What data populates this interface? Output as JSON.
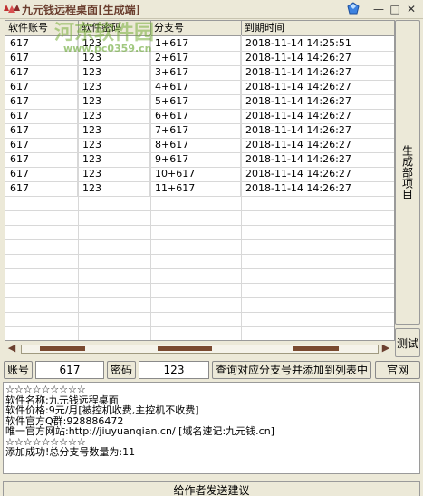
{
  "window": {
    "title": "九元钱远程桌面[生成端]",
    "controls": {
      "minimize": "—",
      "maximize": "□",
      "close": "✕"
    }
  },
  "watermark": {
    "main": "河东软件园",
    "url": "www.pc0359.cn"
  },
  "table": {
    "columns": [
      "软件账号",
      "软件密码",
      "分支号",
      "到期时间"
    ],
    "rows": [
      [
        "617",
        "123",
        "1+617",
        "2018-11-14 14:25:51"
      ],
      [
        "617",
        "123",
        "2+617",
        "2018-11-14 14:26:27"
      ],
      [
        "617",
        "123",
        "3+617",
        "2018-11-14 14:26:27"
      ],
      [
        "617",
        "123",
        "4+617",
        "2018-11-14 14:26:27"
      ],
      [
        "617",
        "123",
        "5+617",
        "2018-11-14 14:26:27"
      ],
      [
        "617",
        "123",
        "6+617",
        "2018-11-14 14:26:27"
      ],
      [
        "617",
        "123",
        "7+617",
        "2018-11-14 14:26:27"
      ],
      [
        "617",
        "123",
        "8+617",
        "2018-11-14 14:26:27"
      ],
      [
        "617",
        "123",
        "9+617",
        "2018-11-14 14:26:27"
      ],
      [
        "617",
        "123",
        "10+617",
        "2018-11-14 14:26:27"
      ],
      [
        "617",
        "123",
        "11+617",
        "2018-11-14 14:26:27"
      ]
    ]
  },
  "side": {
    "generate_label": "生成部项目",
    "test_label": "测试"
  },
  "form": {
    "account_label": "账号",
    "account_value": "617",
    "password_label": "密码",
    "password_value": "123",
    "query_button": "查询对应分支号并添加到列表中",
    "website_button": "官网"
  },
  "log": {
    "lines": [
      "☆☆☆☆☆☆☆☆☆",
      "软件名称:九元钱远程桌面",
      "软件价格:9元/月[被控机收费,主控机不收费]",
      "软件官方Q群:928886472",
      "唯一官方网站:http://jiuyuanqian.cn/  [域名速记:九元钱.cn]",
      "☆☆☆☆☆☆☆☆☆",
      "添加成功!总分支号数量为:11"
    ]
  },
  "bottom": {
    "feedback_button": "给作者发送建议"
  },
  "colors": {
    "window_bg": "#ece9d8",
    "title_text": "#6b3f2f",
    "watermark": "#78af3c"
  }
}
